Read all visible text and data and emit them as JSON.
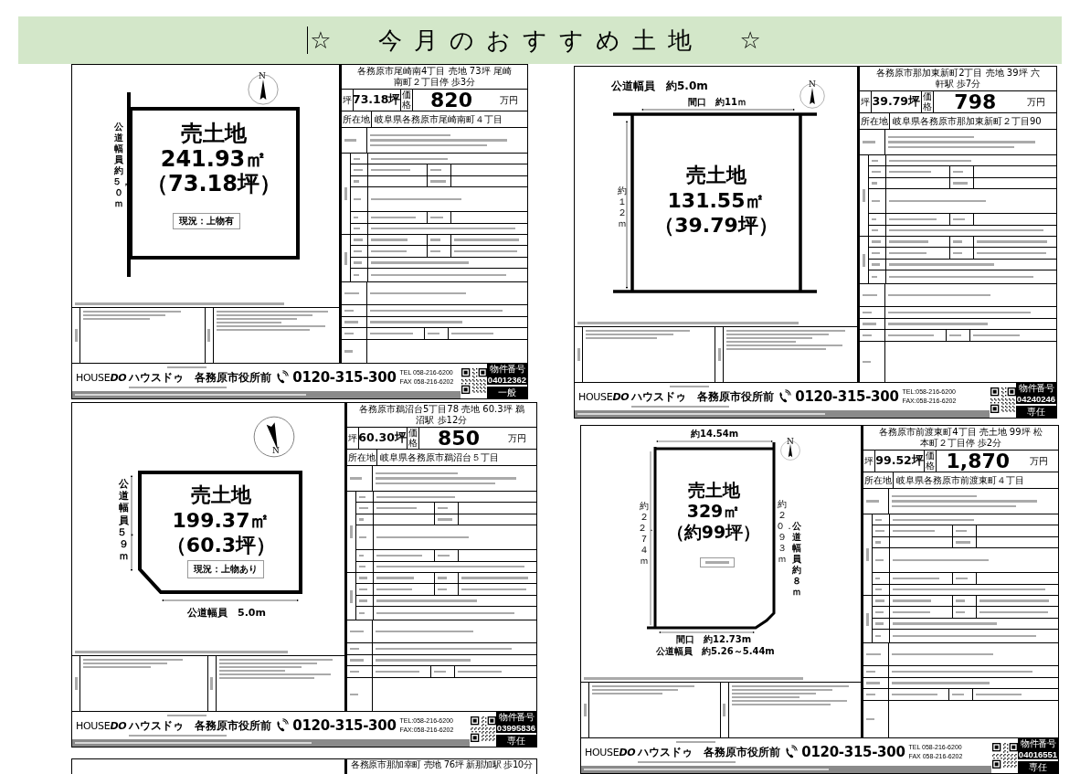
{
  "banner": {
    "title": "☆　今月のおすすめ土地　☆",
    "caret": true
  },
  "columns": [
    {
      "flyers": [
        {
          "kind": "full",
          "plot": {
            "kind": "left-road",
            "north": "N",
            "title": "売土地",
            "area": "241.93㎡",
            "tsubo": "（73.18坪）",
            "status": "現況：上物有",
            "labels": [
              "公道幅員約５，０ｍ"
            ]
          },
          "table": {
            "title": "各務原市尾崎南4丁目 売地 73坪 尾崎南町２丁目停 歩3分",
            "price_row": {
              "tsubo_label": "坪",
              "tsubo": "73.18坪",
              "price_label": "価格",
              "price": "820",
              "unit": "万円"
            },
            "address_label": "所在地",
            "address": "岐阜県各務原市尾崎南町４丁目"
          },
          "footer": {
            "logo": "HOUSE**DO**",
            "shop": "ハウスドゥ　各務原市役所前",
            "phone": "0120-315-300",
            "tel": "TEL 058-216-6200",
            "fax": "FAX 058-216-6202",
            "number_label": "物件番号",
            "number": "04012362",
            "deal": "一般"
          }
        },
        {
          "kind": "full",
          "plot": {
            "kind": "cut-corner",
            "north": "N",
            "title": "売土地",
            "area": "199.37㎡",
            "tsubo": "（60.3坪）",
            "status": "現況：上物あり",
            "labels": [
              "公道幅員５．９ｍ",
              "公道幅員　5.0m"
            ]
          },
          "table": {
            "title": "各務原市鵜沼台5丁目78 売地 60.3坪 鵜沼駅 歩12分",
            "price_row": {
              "tsubo_label": "坪",
              "tsubo": "60.30坪",
              "price_label": "価格",
              "price": "850",
              "unit": "万円"
            },
            "address_label": "所在地",
            "address": "岐阜県各務原市鵜沼台５丁目"
          },
          "footer": {
            "logo": "HOUSE**DO**",
            "shop": "ハウスドゥ　各務原市役所前",
            "phone": "0120-315-300",
            "tel": "TEL:058-216-6200",
            "fax": "FAX:058-216-6202",
            "number_label": "物件番号",
            "number": "03995836",
            "deal": "専任"
          }
        },
        {
          "kind": "partial",
          "table": {
            "title": "各務原市那加幸町 売地 76坪 新那加駅 歩10分"
          }
        }
      ]
    },
    {
      "flyers": [
        {
          "kind": "full",
          "plot": {
            "kind": "top-bottom-road",
            "north": "N",
            "title": "売土地",
            "area": "131.55㎡",
            "tsubo": "（39.79坪）",
            "labels": [
              "公道幅員　約5.0m",
              "間口　約11ｍ",
              "約１２ｍ"
            ]
          },
          "table": {
            "title": "各務原市那加東新町2丁目 売地 39坪 六軒駅 歩7分",
            "price_row": {
              "tsubo_label": "坪",
              "tsubo": "39.79坪",
              "price_label": "価格",
              "price": "798",
              "unit": "万円"
            },
            "address_label": "所在地",
            "address": "岐阜県各務原市那加東新町２丁目90"
          },
          "footer": {
            "logo": "HOUSE**DO**",
            "shop": "ハウスドゥ　各務原市役所前",
            "phone": "0120-315-300",
            "tel": "TEL:058-216-6200",
            "fax": "FAX:058-216-6202",
            "number_label": "物件番号",
            "number": "04240246",
            "deal": "専任"
          }
        },
        {
          "kind": "full",
          "plot": {
            "kind": "trapezoid",
            "north": "N",
            "title": "売土地",
            "area": "329㎡",
            "tsubo": "（約99坪）",
            "labels": [
              "約14.54m",
              "約２２．７４ｍ",
              "約２０．９３ｍ",
              "公道幅員約８ｍ",
              "間口　約12.73m",
              "公道幅員　約5.26～5.44m"
            ]
          },
          "table": {
            "title": "各務原市前渡東町4丁目 売土地 99坪 松本町２丁目停 歩2分",
            "price_row": {
              "tsubo_label": "坪",
              "tsubo": "99.52坪",
              "price_label": "価格",
              "price": "1,870",
              "unit": "万円"
            },
            "address_label": "所在地",
            "address": "岐阜県各務原市前渡東町４丁目"
          },
          "footer": {
            "logo": "HOUSE**DO**",
            "shop": "ハウスドゥ　各務原市役所前",
            "phone": "0120-315-300",
            "tel": "TEL 058-216-6200",
            "fax": "FAX 058-216-6202",
            "number_label": "物件番号",
            "number": "04016551",
            "deal": "専任"
          }
        }
      ]
    }
  ]
}
